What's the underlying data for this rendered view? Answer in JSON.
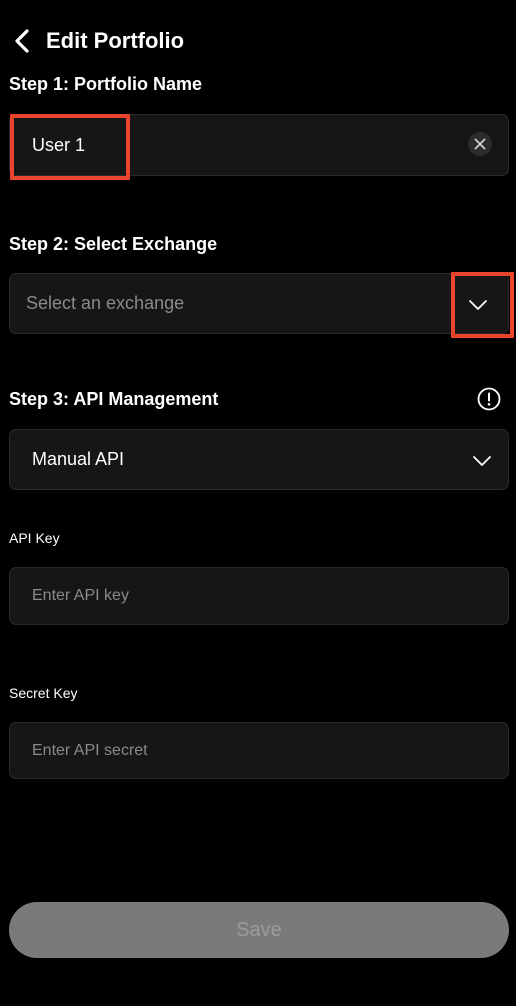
{
  "header": {
    "title": "Edit Portfolio",
    "back_icon": "chevron-left-icon"
  },
  "step1": {
    "label": "Step 1: Portfolio Name",
    "value": "User 1",
    "clear_icon": "close-circle-icon"
  },
  "step2": {
    "label": "Step 2: Select Exchange",
    "placeholder": "Select an exchange",
    "dropdown_icon": "chevron-down-icon"
  },
  "step3": {
    "label": "Step 3: API Management",
    "info_icon": "info-circle-icon",
    "selected": "Manual API",
    "api_key": {
      "label": "API Key",
      "placeholder": "Enter API key"
    },
    "secret_key": {
      "label": "Secret Key",
      "placeholder": "Enter API secret"
    }
  },
  "footer": {
    "save_label": "Save"
  },
  "colors": {
    "background": "#000000",
    "field": "#161616",
    "highlight": "#e8452c",
    "save_button": "#7a7a7a"
  }
}
